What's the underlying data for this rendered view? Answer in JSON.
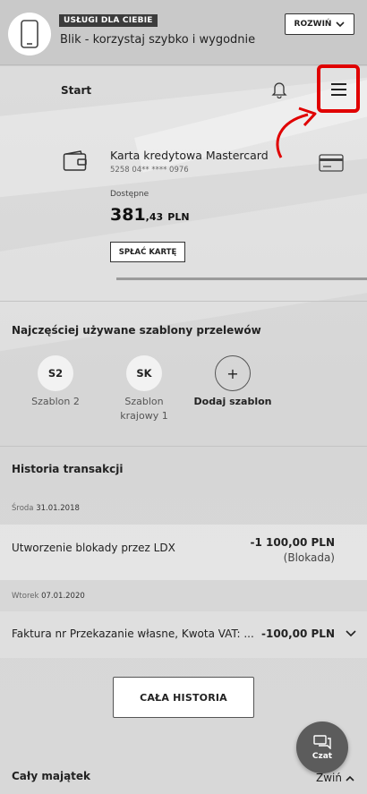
{
  "banner": {
    "tag": "USŁUGI DLA CIEBIE",
    "text": "Blik - korzystaj szybko i wygodnie",
    "expand_label": "ROZWIŃ",
    "icon": "smartphone-icon"
  },
  "header": {
    "title": "Start",
    "bell_icon": "bell-icon",
    "menu_icon": "hamburger-menu-icon",
    "highlight_color": "#e00000"
  },
  "card": {
    "name": "Karta kredytowa Mastercard",
    "number": "5258 04** **** 0976",
    "available_label": "Dostępne",
    "amount_whole": "381",
    "amount_fraction": ",43",
    "currency": "PLN",
    "pay_button": "SPŁAĆ KARTĘ"
  },
  "templates": {
    "title": "Najczęściej używane szablony przelewów",
    "items": [
      {
        "abbr": "S2",
        "label": "Szablon 2"
      },
      {
        "abbr": "SK",
        "label_line1": "Szablon",
        "label_line2": "krajowy 1"
      },
      {
        "abbr": "+",
        "label": "Dodaj szablon"
      }
    ]
  },
  "history": {
    "title": "Historia transakcji",
    "groups": [
      {
        "day": "Środa",
        "date": "31.01.2018",
        "description": "Utworzenie blokady przez LDX",
        "amount": "-1 100,00 PLN",
        "status": "(Blokada)"
      },
      {
        "day": "Wtorek",
        "date": "07.01.2020",
        "description": "Faktura nr Przekazanie własne, Kwota VAT: ...",
        "amount": "-100,00 PLN"
      }
    ],
    "all_button": "CAŁA HISTORIA"
  },
  "chat": {
    "label": "Czat"
  },
  "assets": {
    "title": "Cały majątek",
    "collapse_label": "Zwiń"
  }
}
